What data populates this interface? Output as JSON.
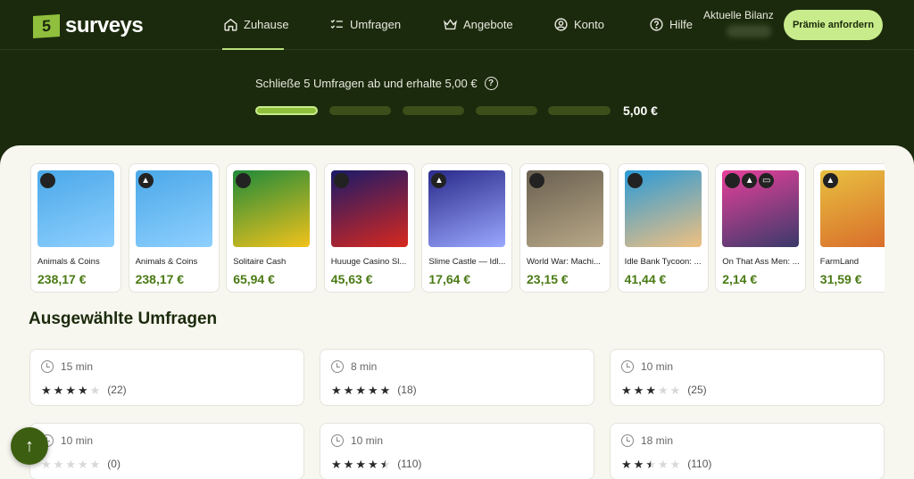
{
  "brand": {
    "logo_number": "5",
    "logo_text": "surveys"
  },
  "nav": {
    "home": "Zuhause",
    "surveys": "Umfragen",
    "offers": "Angebote",
    "account": "Konto",
    "help": "Hilfe"
  },
  "balance": {
    "label": "Aktuelle Bilanz"
  },
  "reward_button": "Prämie anfordern",
  "progress": {
    "text": "Schließe 5 Umfragen ab und erhalte 5,00 €",
    "help_glyph": "?",
    "amount": "5,00 €",
    "completed_segments": 1,
    "total_segments": 5
  },
  "offers": [
    {
      "name": "Animals & Coins",
      "price": "238,17 €",
      "platforms": [
        "apple-icon"
      ],
      "colors": [
        "#4aa8e8",
        "#8fd0ff"
      ]
    },
    {
      "name": "Animals & Coins",
      "price": "238,17 €",
      "platforms": [
        "android-icon"
      ],
      "colors": [
        "#4aa8e8",
        "#8fd0ff"
      ]
    },
    {
      "name": "Solitaire Cash",
      "price": "65,94 €",
      "platforms": [
        "apple-icon"
      ],
      "colors": [
        "#1f8a3a",
        "#f2c21b"
      ]
    },
    {
      "name": "Huuuge Casino Sl...",
      "price": "45,63 €",
      "platforms": [
        "apple-icon"
      ],
      "colors": [
        "#1a1a6a",
        "#d8281e"
      ]
    },
    {
      "name": "Slime Castle — Idl...",
      "price": "17,64 €",
      "platforms": [
        "android-icon"
      ],
      "colors": [
        "#2a2a8a",
        "#9aa8ff"
      ]
    },
    {
      "name": "World War: Machi...",
      "price": "23,15 €",
      "platforms": [
        "apple-icon"
      ],
      "colors": [
        "#6a6050",
        "#b8a888"
      ]
    },
    {
      "name": "Idle Bank Tycoon: ...",
      "price": "41,44 €",
      "platforms": [
        "apple-icon"
      ],
      "colors": [
        "#2a9ad8",
        "#f0c080"
      ]
    },
    {
      "name": "On That Ass Men: ...",
      "price": "2,14 €",
      "platforms": [
        "apple-icon",
        "android-icon",
        "desktop-icon"
      ],
      "colors": [
        "#e8409a",
        "#3a3a6a"
      ]
    },
    {
      "name": "FarmLand",
      "price": "31,59 €",
      "platforms": [
        "android-icon"
      ],
      "colors": [
        "#e8c040",
        "#d86a2a"
      ]
    }
  ],
  "section_title": "Ausgewählte Umfragen",
  "surveys": [
    {
      "time": "15 min",
      "rating": 4,
      "reviews": "(22)"
    },
    {
      "time": "8 min",
      "rating": 5,
      "reviews": "(18)"
    },
    {
      "time": "10 min",
      "rating": 3,
      "reviews": "(25)"
    },
    {
      "time": "10 min",
      "rating": 0,
      "reviews": "(0)"
    },
    {
      "time": "10 min",
      "rating": 4.5,
      "reviews": "(110)"
    },
    {
      "time": "18 min",
      "rating": 2.5,
      "reviews": "(110)"
    }
  ],
  "scroll_top_glyph": "↑"
}
